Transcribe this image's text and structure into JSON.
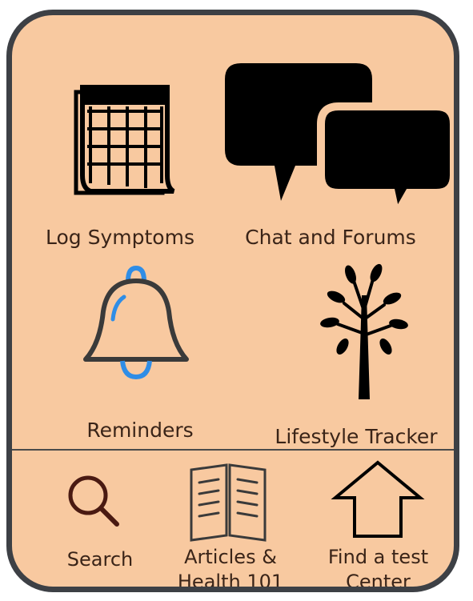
{
  "app": {
    "tiles": {
      "log_symptoms": {
        "label": "Log Symptoms",
        "icon": "calendar-icon"
      },
      "chat_forums": {
        "label": "Chat and Forums",
        "icon": "chat-bubbles-icon"
      },
      "reminders": {
        "label": "Reminders",
        "icon": "bell-icon"
      },
      "lifestyle_tracker": {
        "label": "Lifestyle Tracker",
        "icon": "tree-icon"
      }
    },
    "bottom_nav": {
      "search": {
        "label": "Search",
        "icon": "search-icon"
      },
      "articles": {
        "label": "Articles &\nHealth 101",
        "icon": "open-book-icon"
      },
      "find_center": {
        "label": "Find a test\nCenter",
        "icon": "house-icon"
      }
    },
    "colors": {
      "background": "#f8c9a0",
      "frame_border": "#3d4045",
      "text": "#3a2418",
      "bell_accent": "#2f8de6",
      "search_icon": "#4a1a12"
    }
  }
}
